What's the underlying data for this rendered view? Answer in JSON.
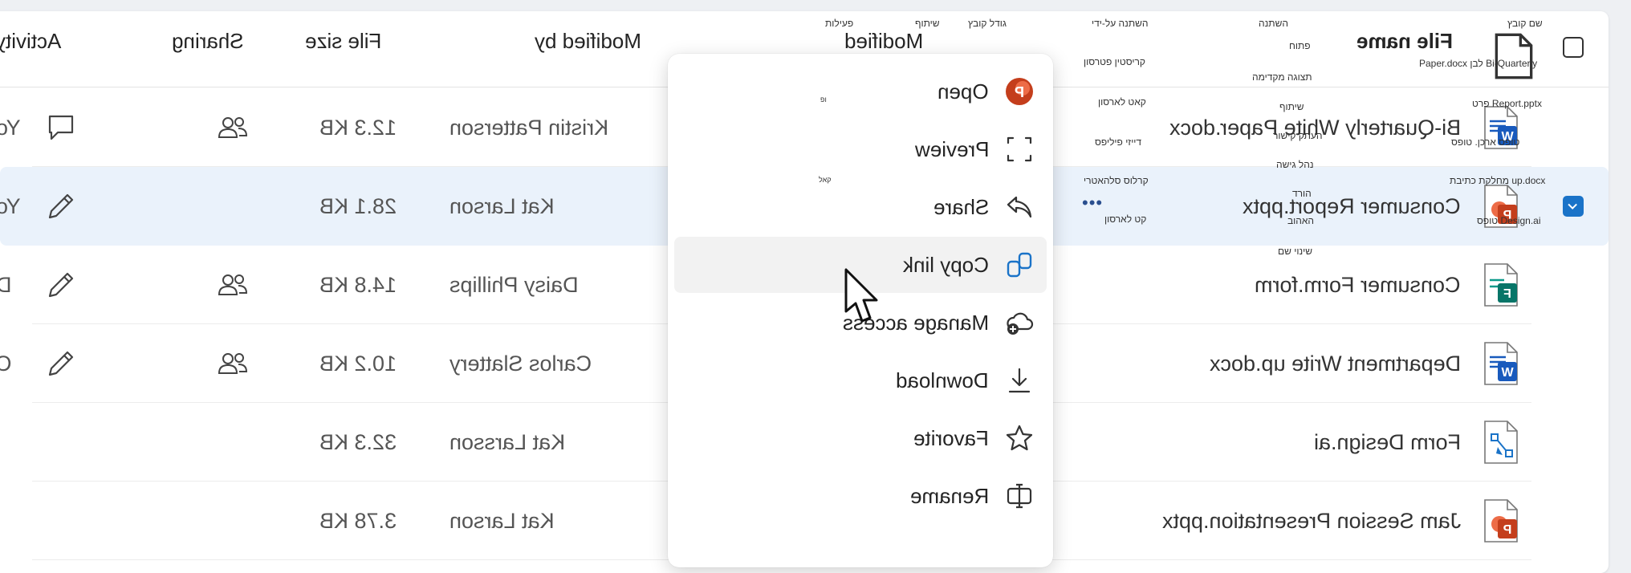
{
  "header": {
    "file_name": "File name",
    "modified": "Modified",
    "modified_by": "Modified by",
    "file_size": "File size",
    "sharing": "Sharing",
    "activity": "Activity"
  },
  "tiny_labels": {
    "col_file_name": "שם קובץ",
    "col_modified": "השתנה",
    "col_modified_by": "השתנה על-ידי",
    "col_file_size": "גודל קובץ",
    "col_sharing": "שיתוף",
    "col_activity": "פעילות",
    "menu_open": "פתוח",
    "menu_preview": "תצוגה מקדימה",
    "menu_share": "שיתוף",
    "menu_copy_link": "העתק קישור",
    "menu_manage_access": "נהל גישה",
    "menu_download": "הורד",
    "menu_favorite": "האהוב",
    "menu_rename": "שינוי שם",
    "name_kristin": "קריסטין פטרסון",
    "name_kat": "קאט לארסון",
    "name_daisy": "דייזי פיליפס",
    "name_carlos": "קרלוס סלהאטרי",
    "name_kat2": "קט לארסון",
    "file_bi_quarterly": "Bi-Quarterly לבן Paper.docx",
    "file_consumer_report": "Report.pptx פרט",
    "file_form": "טופס ארכן. טופס",
    "file_dept": "up.docx מחלקת כתיבת",
    "file_design": "Design.ai טופס",
    "mark1": "ופ",
    "mark2": "קאל"
  },
  "rows": [
    {
      "name": "Bi-Quarterly White Paper.docx",
      "type": "word",
      "modified_by": "Kristin Patterson",
      "size": "12.3 KB",
      "sharing": true,
      "activity": "You",
      "activity_icon": "comment-icon"
    },
    {
      "name": "Consumer Report.pptx",
      "type": "ppt",
      "modified_by": "Kat Larson",
      "size": "28.1 KB",
      "sharing": false,
      "activity": "You",
      "activity_icon": "pencil-icon",
      "selected": true
    },
    {
      "name": "Consumer Form.form",
      "type": "form",
      "modified_by": "Daisy Phillips",
      "size": "14.8 KB",
      "sharing": true,
      "activity": "Da",
      "activity_icon": "pencil-icon"
    },
    {
      "name": "Department Write up.docx",
      "type": "word",
      "modified_by": "Carlos Slattery",
      "size": "10.2 KB",
      "sharing": true,
      "activity": "Ca",
      "activity_icon": "pencil-icon"
    },
    {
      "name": "Form Design.ai",
      "type": "ai",
      "modified_by": "Kat Larsson",
      "size": "32.3 KB",
      "sharing": false,
      "activity": "",
      "activity_icon": ""
    },
    {
      "name": "Jam Session Presentation.pptx",
      "type": "ppt",
      "modified_by": "Kat Larson",
      "size": "3.78 KB",
      "sharing": false,
      "activity": "",
      "activity_icon": ""
    }
  ],
  "more_glyph": "•••",
  "context_menu": {
    "items": [
      {
        "label": "Open",
        "icon": "powerpoint-icon"
      },
      {
        "label": "Preview",
        "icon": "preview-icon"
      },
      {
        "label": "Share",
        "icon": "share-icon"
      },
      {
        "label": "Copy link",
        "icon": "link-icon",
        "highlighted": true
      },
      {
        "label": "Manage access",
        "icon": "cloud-add-icon"
      },
      {
        "label": "Download",
        "icon": "download-icon"
      },
      {
        "label": "Favorite",
        "icon": "star-icon"
      },
      {
        "label": "Rename",
        "icon": "rename-icon"
      }
    ]
  },
  "colors": {
    "accent": "#1a73c8",
    "selected_row": "#eaf2fb",
    "word_blue": "#185abd",
    "ppt_orange": "#c43e1c",
    "forms_teal": "#077568"
  }
}
